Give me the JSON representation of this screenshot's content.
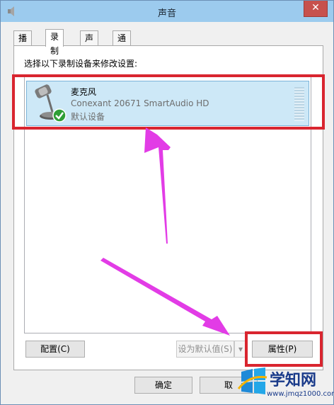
{
  "window": {
    "title": "声音"
  },
  "tabs": [
    {
      "label": "播放"
    },
    {
      "label": "录制"
    },
    {
      "label": "声音"
    },
    {
      "label": "通信"
    }
  ],
  "active_tab": "录制",
  "panel": {
    "instruction": "选择以下录制设备来修改设置:"
  },
  "device": {
    "name": "麦克风",
    "description": "Conexant 20671 SmartAudio HD",
    "status": "默认设备",
    "icon": "microphone-icon",
    "badge_icon": "check-icon"
  },
  "buttons": {
    "configure": "配置(C)",
    "set_default": "设为默认值(S)",
    "properties": "属性(P)",
    "ok": "确定",
    "cancel": "取"
  },
  "watermark": {
    "text": "学知网",
    "url": "www.jmqz1000.com"
  },
  "colors": {
    "title_bar": "#9ccbee",
    "selection": "#cde8f7",
    "highlight_box": "#d9252f",
    "arrow": "#e23ce6"
  }
}
